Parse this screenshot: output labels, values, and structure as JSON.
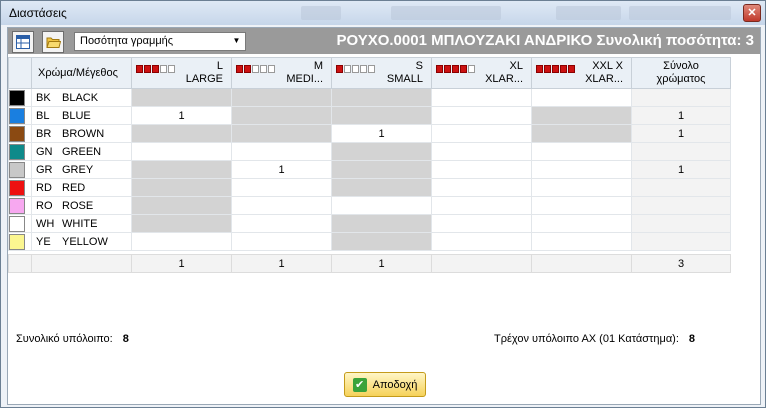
{
  "window": {
    "title": "Διαστάσεις",
    "close_glyph": "✕"
  },
  "toolbar": {
    "combo_value": "Ποσότητα γραμμής",
    "headline": "ΡΟΥΧΟ.0001 ΜΠΛΟΥΖΑΚΙ ΑΝΔΡΙΚΟ Συνολική ποσότητα: 3"
  },
  "grid": {
    "corner_label": "Χρώμα/Μέγεθος",
    "total_header": "Σύνολο χρώματος",
    "sizes": [
      {
        "code": "L",
        "name": "LARGE",
        "dots": 3
      },
      {
        "code": "M",
        "name": "MEDI...",
        "dots": 2
      },
      {
        "code": "S",
        "name": "SMALL",
        "dots": 1
      },
      {
        "code": "XL",
        "name": "XLAR...",
        "dots": 4
      },
      {
        "code": "XXL X",
        "name": "XLAR...",
        "dots": 5
      }
    ],
    "rows": [
      {
        "code": "BK",
        "name": "BLACK",
        "color": "#000000",
        "cells": [
          "",
          "",
          "",
          "",
          ""
        ],
        "disabled": [
          true,
          true,
          true,
          false,
          false
        ],
        "total": ""
      },
      {
        "code": "BL",
        "name": "BLUE",
        "color": "#1a7fe0",
        "cells": [
          "1",
          "",
          "",
          "",
          ""
        ],
        "disabled": [
          false,
          true,
          true,
          false,
          true
        ],
        "total": "1"
      },
      {
        "code": "BR",
        "name": "BROWN",
        "color": "#8b4a12",
        "cells": [
          "",
          "",
          "1",
          "",
          ""
        ],
        "disabled": [
          true,
          true,
          false,
          false,
          true
        ],
        "total": "1"
      },
      {
        "code": "GN",
        "name": "GREEN",
        "color": "#0e8a8a",
        "cells": [
          "",
          "",
          "",
          "",
          ""
        ],
        "disabled": [
          false,
          false,
          true,
          false,
          false
        ],
        "total": ""
      },
      {
        "code": "GR",
        "name": "GREY",
        "color": "#c8c8c8",
        "cells": [
          "",
          "1",
          "",
          "",
          ""
        ],
        "disabled": [
          true,
          false,
          true,
          false,
          false
        ],
        "total": "1"
      },
      {
        "code": "RD",
        "name": "RED",
        "color": "#ee1010",
        "cells": [
          "",
          "",
          "",
          "",
          ""
        ],
        "disabled": [
          true,
          false,
          true,
          false,
          false
        ],
        "total": ""
      },
      {
        "code": "RO",
        "name": "ROSE",
        "color": "#f7a8f0",
        "cells": [
          "",
          "",
          "",
          "",
          ""
        ],
        "disabled": [
          true,
          false,
          false,
          false,
          false
        ],
        "total": ""
      },
      {
        "code": "WH",
        "name": "WHITE",
        "color": "#ffffff",
        "cells": [
          "",
          "",
          "",
          "",
          ""
        ],
        "disabled": [
          true,
          false,
          true,
          false,
          false
        ],
        "total": ""
      },
      {
        "code": "YE",
        "name": "YELLOW",
        "color": "#fbf690",
        "cells": [
          "",
          "",
          "",
          "",
          ""
        ],
        "disabled": [
          false,
          false,
          true,
          false,
          false
        ],
        "total": ""
      }
    ],
    "footer": {
      "cells": [
        "1",
        "1",
        "1",
        "",
        ""
      ],
      "total": "3"
    }
  },
  "info": {
    "left_label": "Συνολικό υπόλοιπο:",
    "left_value": "8",
    "right_label": "Τρέχον υπόλοιπο ΑΧ (01 Κατάστημα):",
    "right_value": "8"
  },
  "accept_label": "Αποδοχή"
}
